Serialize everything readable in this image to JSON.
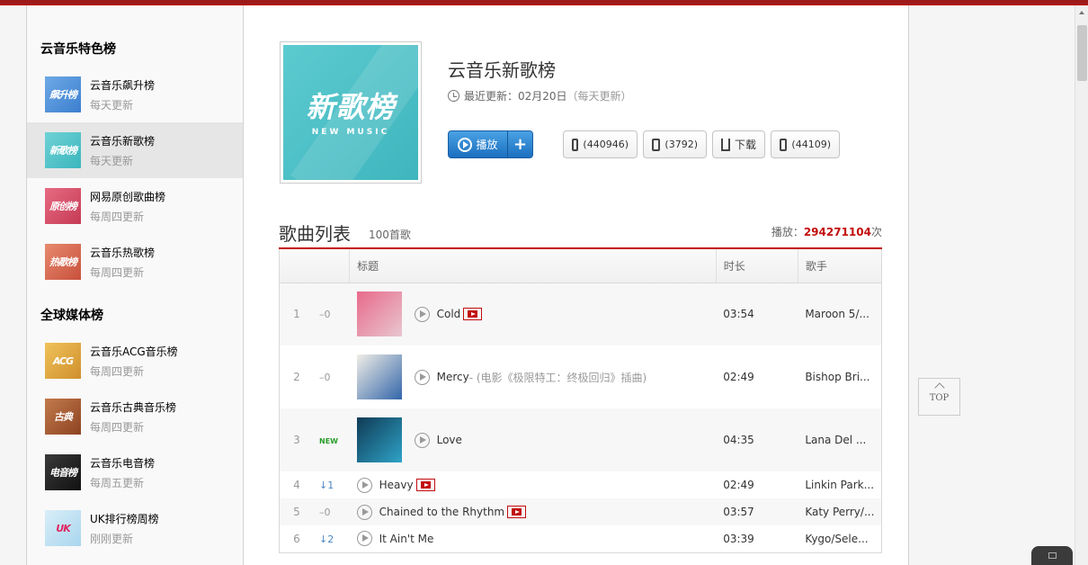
{
  "sidebar": {
    "sections": [
      {
        "title": "云音乐特色榜",
        "items": [
          {
            "name": "云音乐飙升榜",
            "sub": "每天更新",
            "thumb": "飙升榜",
            "color": "#4a8fd6"
          },
          {
            "name": "云音乐新歌榜",
            "sub": "每天更新",
            "thumb": "新歌榜",
            "color": "#4cc0c6"
          },
          {
            "name": "网易原创歌曲榜",
            "sub": "每周四更新",
            "thumb": "原创榜",
            "color": "#d8485f"
          },
          {
            "name": "云音乐热歌榜",
            "sub": "每周四更新",
            "thumb": "热歌榜",
            "color": "#d2604c"
          }
        ]
      },
      {
        "title": "全球媒体榜",
        "items": [
          {
            "name": "云音乐ACG音乐榜",
            "sub": "每周四更新",
            "thumb": "ACG",
            "color": "#d9a23a"
          },
          {
            "name": "云音乐古典音乐榜",
            "sub": "每周四更新",
            "thumb": "古典",
            "color": "#a0532e"
          },
          {
            "name": "云音乐电音榜",
            "sub": "每周五更新",
            "thumb": "电音榜",
            "color": "#222222"
          },
          {
            "name": "UK排行榜周榜",
            "sub": "刚刚更新",
            "thumb": "UK",
            "color": "#bfe3f4"
          }
        ]
      }
    ]
  },
  "playlist": {
    "cover_main": "新歌榜",
    "cover_sub": "NEW MUSIC",
    "title": "云音乐新歌榜",
    "update_label": "最近更新：02月20日",
    "update_freq": "（每天更新）",
    "play_label": "播放",
    "plus_label": "+",
    "collect_count": "(440946)",
    "share_count": "(3792)",
    "download_label": "下载",
    "comment_count": "(44109)"
  },
  "song_list": {
    "title": "歌曲列表",
    "count": "100首歌",
    "plays_label": "播放：",
    "plays_value": "294271104",
    "plays_unit": "次",
    "headers": {
      "title": "标题",
      "duration": "时长",
      "artist": "歌手"
    },
    "songs": [
      {
        "rank": "1",
        "trend": "–0",
        "title": "Cold",
        "alias": "",
        "mv": true,
        "duration": "03:54",
        "artist": "Maroon 5/...",
        "cover": true,
        "cover_colors": [
          "#e86a8a",
          "#e8c6d0"
        ]
      },
      {
        "rank": "2",
        "trend": "–0",
        "title": "Mercy",
        "alias": " - (电影《极限特工：终极回归》插曲)",
        "mv": false,
        "duration": "02:49",
        "artist": "Bishop Bri...",
        "cover": true,
        "cover_colors": [
          "#f1eee6",
          "#3366aa"
        ]
      },
      {
        "rank": "3",
        "trend": "NEW",
        "title": "Love",
        "alias": "",
        "mv": false,
        "duration": "04:35",
        "artist": "Lana Del ...",
        "cover": true,
        "cover_colors": [
          "#0f3a55",
          "#2fa3c7"
        ]
      },
      {
        "rank": "4",
        "trend": "↓1",
        "title": "Heavy",
        "alias": "",
        "mv": true,
        "duration": "02:49",
        "artist": "Linkin Park...",
        "cover": false
      },
      {
        "rank": "5",
        "trend": "–0",
        "title": "Chained to the Rhythm",
        "alias": "",
        "mv": true,
        "duration": "03:57",
        "artist": "Katy Perry/...",
        "cover": false
      },
      {
        "rank": "6",
        "trend": "↓2",
        "title": "It Ain't Me",
        "alias": "",
        "mv": false,
        "duration": "03:39",
        "artist": "Kygo/Sele...",
        "cover": false
      }
    ]
  },
  "to_top_label": "TOP",
  "colors": {
    "accent": "#c20c0c",
    "play_button": "#2b7ed0"
  }
}
